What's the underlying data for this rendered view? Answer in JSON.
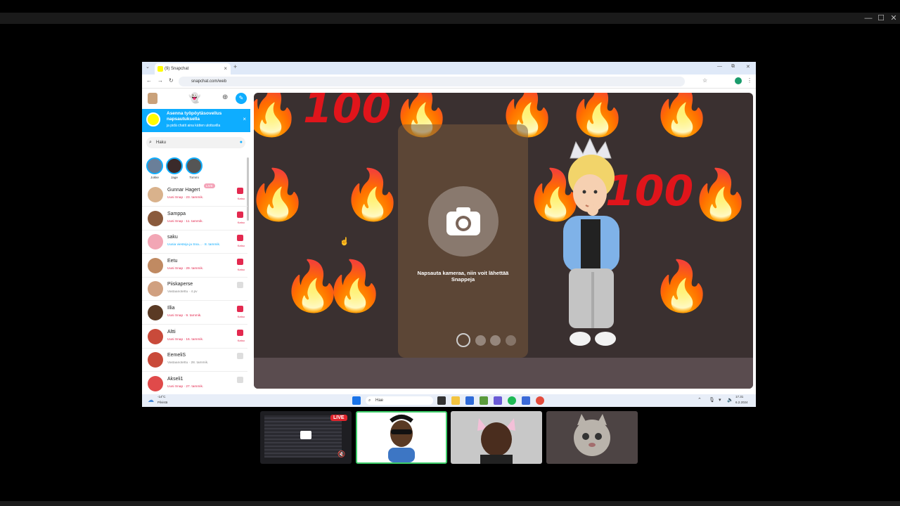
{
  "window_controls": [
    "—",
    "☐",
    "✕"
  ],
  "browser": {
    "tab_title": "(9) Snapchat",
    "tab_close": "×",
    "new_tab": "+",
    "url": "snapchat.com/web",
    "win_controls": [
      "—",
      "⧉",
      "✕"
    ]
  },
  "sidebar": {
    "banner_title": "Asenna työpöytäsovellus napsautuksella",
    "banner_sub": "ja pidä chatit aina kätten ulottuvilla",
    "banner_close": "×",
    "search_placeholder": "Haku",
    "stories": [
      {
        "label": "Jokke"
      },
      {
        "label": "Jage"
      },
      {
        "label": "Tommi"
      }
    ],
    "live_badge": "LIVE",
    "chats": [
      {
        "name": "Gunnar Hagert",
        "status": "Uusi Snap · 23. tammik.",
        "action": "Katso"
      },
      {
        "name": "Samppa",
        "status": "Uusi Snap · 11. tammik.",
        "action": "Katso"
      },
      {
        "name": "saku",
        "status": "Uusia viesteja ja Sna... · 8. tammik.",
        "action": "Katso"
      },
      {
        "name": "Eetu",
        "status": "Uusi Snap · 29. tammik.",
        "action": "Katso"
      },
      {
        "name": "Piiskaperse",
        "status": "Vastaanotettu · 4 pv",
        "action": ""
      },
      {
        "name": "Illia",
        "status": "Uusi Snap · 9. tammik.",
        "action": "Katso"
      },
      {
        "name": "Altti",
        "status": "Uusi Snap · 16. tammik.",
        "action": "Katso"
      },
      {
        "name": "EemeliS",
        "status": "Vastaanotettu · 28. tammik.",
        "action": ""
      },
      {
        "name": "Akseli1",
        "status": "Uusi Snap · 27. tammik.",
        "action": ""
      }
    ]
  },
  "camera": {
    "prompt": "Napsauta kameraa, niin voit lähettää Snappeja"
  },
  "taskbar": {
    "weather_temp": "-14°C",
    "weather_desc": "Pilvistä",
    "search_placeholder": "Hae",
    "time": "17.31",
    "date": "6.2.2024"
  },
  "call": {
    "live_badge": "LIVE",
    "participants": [
      "screen-share",
      "participant-1",
      "participant-2",
      "participant-3"
    ]
  },
  "colors": {
    "snap_yellow": "#fffc00",
    "snap_blue": "#0eadff",
    "snap_red": "#e3294f",
    "live_red": "#e0242c"
  }
}
